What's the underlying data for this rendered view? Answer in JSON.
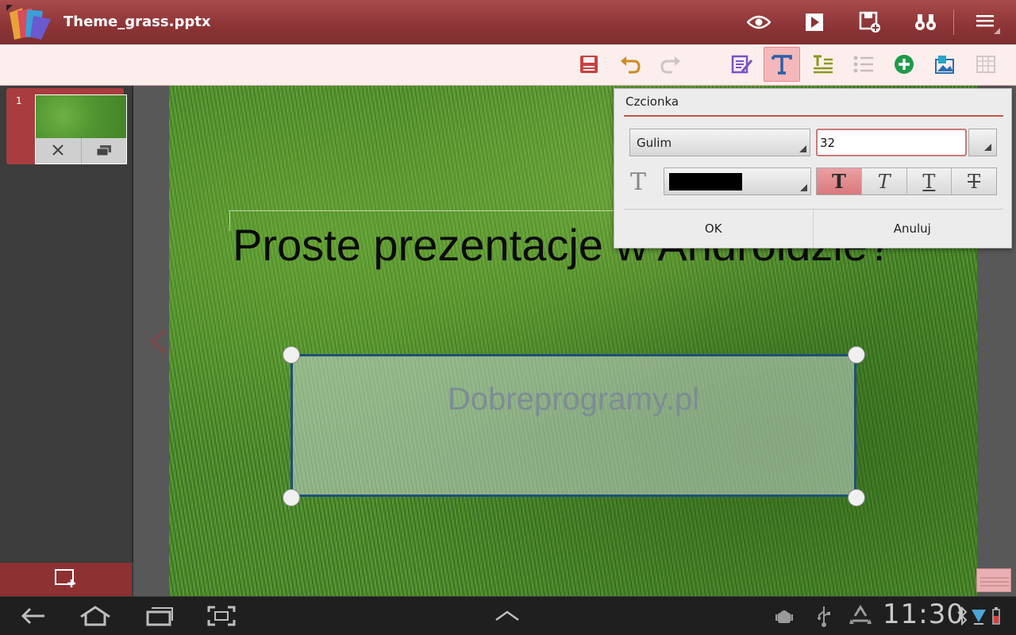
{
  "app": {
    "document_title": "Theme_grass.pptx"
  },
  "titlebar": {
    "icons": [
      "eye-icon",
      "play-icon",
      "save-as-icon",
      "binoculars-icon",
      "menu-icon"
    ]
  },
  "toolbar": {
    "tools": [
      "save-icon",
      "undo-icon",
      "redo-icon",
      "edit-text-icon",
      "text-format-icon",
      "paragraph-icon",
      "bullet-list-icon",
      "add-icon",
      "insert-image-icon",
      "table-icon"
    ],
    "active_tool": "text-format-icon"
  },
  "slides_panel": {
    "slides": [
      {
        "number": "1"
      }
    ]
  },
  "slide": {
    "title_text": "Proste prezentacje w Androidzie?",
    "textbox_text": "Dobreprogramy.pl"
  },
  "font_dialog": {
    "title": "Czcionka",
    "font_family": "Gulim",
    "font_size": "32",
    "font_color": "#000000",
    "styles": [
      {
        "label": "T",
        "name": "bold",
        "active": true
      },
      {
        "label": "T",
        "name": "italic",
        "active": false
      },
      {
        "label": "T",
        "name": "underline",
        "active": false
      },
      {
        "label": "T",
        "name": "strikethrough",
        "active": false
      }
    ],
    "ok_label": "OK",
    "cancel_label": "Anuluj"
  },
  "system_bar": {
    "time": "11:30"
  },
  "colors": {
    "titlebar": "#8c3436",
    "toolbar": "#fdeeee",
    "accent": "#c8524b",
    "selection_border": "#1f4f7a"
  }
}
